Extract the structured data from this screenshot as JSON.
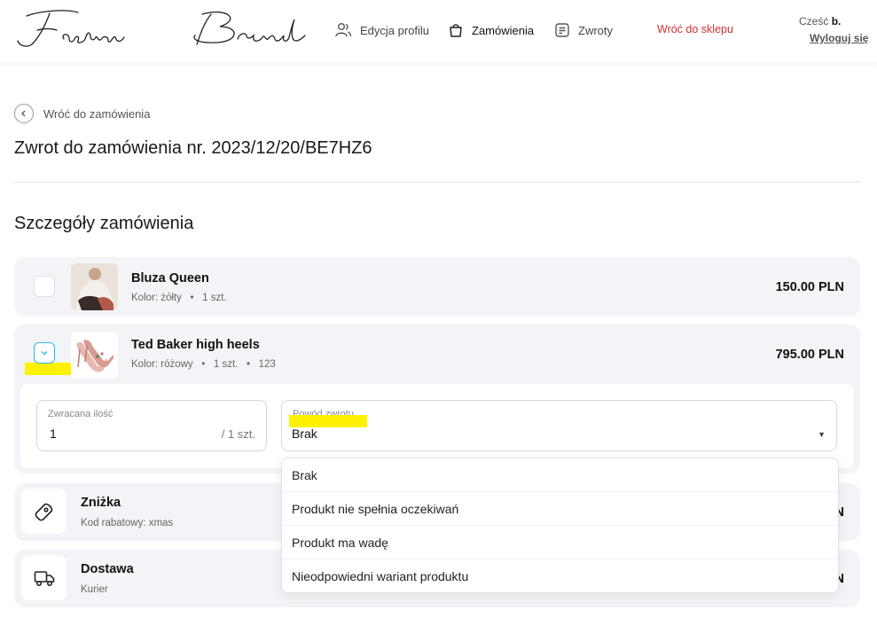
{
  "header": {
    "nav": [
      {
        "label": "Edycja profilu",
        "icon": "users-icon"
      },
      {
        "label": "Zamówienia",
        "icon": "shopping-bag-icon"
      },
      {
        "label": "Zwroty",
        "icon": "returns-list-icon"
      }
    ],
    "back_to_shop": "Wróć do sklepu",
    "greeting_prefix": "Cześć",
    "greeting_name": "b.",
    "logout": "Wyloguj się"
  },
  "back_link": "Wróć do zamówienia",
  "page_title": "Zwrot do zamówienia nr. 2023/12/20/BE7HZ6",
  "section_title": "Szczegóły zamówienia",
  "items": [
    {
      "name": "Bluza Queen",
      "color": "Kolor: żółty",
      "qty": "1 szt.",
      "extra": "",
      "price": "150.00 PLN",
      "checked": false
    },
    {
      "name": "Ted Baker high heels",
      "color": "Kolor: różowy",
      "qty": "1 szt.",
      "extra": "123",
      "price": "795.00 PLN",
      "checked": true
    }
  ],
  "return_form": {
    "qty_label": "Zwracana ilość",
    "qty_value": "1",
    "qty_suffix": "/ 1 szt.",
    "reason_label": "Powód zwrotu",
    "reason_value": "Brak",
    "reason_options": [
      "Brak",
      "Produkt nie spełnia oczekiwań",
      "Produkt ma wadę",
      "Nieodpowiedni wariant produktu"
    ]
  },
  "discount": {
    "title": "Zniżka",
    "sub": "Kod rabatowy: xmas",
    "price_peek": "N"
  },
  "shipping": {
    "title": "Dostawa",
    "sub": "Kurier",
    "price_peek": "N"
  },
  "colors": {
    "accent_red": "#d32f2f",
    "highlight": "#fff200",
    "checkbox_blue": "#29b6f6"
  }
}
